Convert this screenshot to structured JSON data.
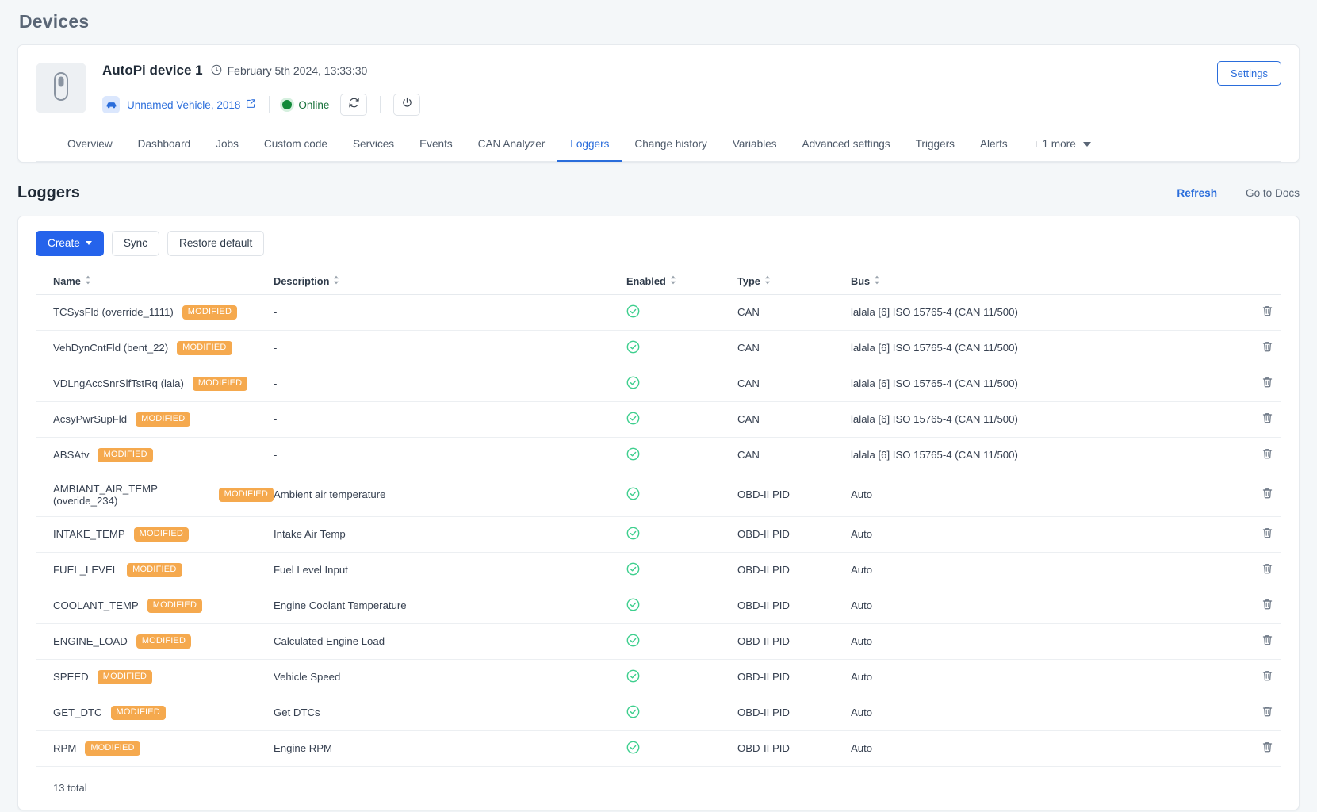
{
  "page": {
    "title": "Devices"
  },
  "device": {
    "thumb_icon": "usb-dongle-icon",
    "name": "AutoPi device 1",
    "clock_icon": "clock-icon",
    "date": "February 5th 2024, 13:33:30",
    "vehicle_icon": "car-icon",
    "vehicle_link": "Unnamed Vehicle, 2018",
    "external_link_icon": "external-link-icon",
    "status": "Online",
    "status_color": "#17713a",
    "refresh_icon": "refresh-icon",
    "power_icon": "power-icon",
    "settings_label": "Settings"
  },
  "tabs": [
    {
      "label": "Overview",
      "active": false
    },
    {
      "label": "Dashboard",
      "active": false
    },
    {
      "label": "Jobs",
      "active": false
    },
    {
      "label": "Custom code",
      "active": false
    },
    {
      "label": "Services",
      "active": false
    },
    {
      "label": "Events",
      "active": false
    },
    {
      "label": "CAN Analyzer",
      "active": false
    },
    {
      "label": "Loggers",
      "active": true
    },
    {
      "label": "Change history",
      "active": false
    },
    {
      "label": "Variables",
      "active": false
    },
    {
      "label": "Advanced settings",
      "active": false
    },
    {
      "label": "Triggers",
      "active": false
    },
    {
      "label": "Alerts",
      "active": false
    }
  ],
  "tabs_more": "+ 1 more",
  "section": {
    "title": "Loggers",
    "refresh_label": "Refresh",
    "docs_label": "Go to Docs"
  },
  "toolbar": {
    "create_label": "Create",
    "sync_label": "Sync",
    "restore_label": "Restore default"
  },
  "table": {
    "columns": [
      "Name",
      "Description",
      "Enabled",
      "Type",
      "Bus"
    ],
    "badge_label": "MODIFIED",
    "badge_color": "#f5a94e",
    "enabled_icon": "check-circle-icon",
    "enabled_color": "#3ecf8e",
    "delete_icon": "trash-icon",
    "rows": [
      {
        "name": "TCSysFld (override_1111)",
        "badge": "MODIFIED",
        "description": "-",
        "enabled": true,
        "type": "CAN",
        "bus": "lalala [6] ISO 15765-4 (CAN 11/500)"
      },
      {
        "name": "VehDynCntFld (bent_22)",
        "badge": "MODIFIED",
        "description": "-",
        "enabled": true,
        "type": "CAN",
        "bus": "lalala [6] ISO 15765-4 (CAN 11/500)"
      },
      {
        "name": "VDLngAccSnrSlfTstRq (lala)",
        "badge": "MODIFIED",
        "description": "-",
        "enabled": true,
        "type": "CAN",
        "bus": "lalala [6] ISO 15765-4 (CAN 11/500)"
      },
      {
        "name": "AcsyPwrSupFld",
        "badge": "MODIFIED",
        "description": "-",
        "enabled": true,
        "type": "CAN",
        "bus": "lalala [6] ISO 15765-4 (CAN 11/500)"
      },
      {
        "name": "ABSAtv",
        "badge": "MODIFIED",
        "description": "-",
        "enabled": true,
        "type": "CAN",
        "bus": "lalala [6] ISO 15765-4 (CAN 11/500)"
      },
      {
        "name": "AMBIANT_AIR_TEMP (overide_234)",
        "badge": "MODIFIED",
        "description": "Ambient air temperature",
        "enabled": true,
        "type": "OBD-II PID",
        "bus": "Auto"
      },
      {
        "name": "INTAKE_TEMP",
        "badge": "MODIFIED",
        "description": "Intake Air Temp",
        "enabled": true,
        "type": "OBD-II PID",
        "bus": "Auto"
      },
      {
        "name": "FUEL_LEVEL",
        "badge": "MODIFIED",
        "description": "Fuel Level Input",
        "enabled": true,
        "type": "OBD-II PID",
        "bus": "Auto"
      },
      {
        "name": "COOLANT_TEMP",
        "badge": "MODIFIED",
        "description": "Engine Coolant Temperature",
        "enabled": true,
        "type": "OBD-II PID",
        "bus": "Auto"
      },
      {
        "name": "ENGINE_LOAD",
        "badge": "MODIFIED",
        "description": "Calculated Engine Load",
        "enabled": true,
        "type": "OBD-II PID",
        "bus": "Auto"
      },
      {
        "name": "SPEED",
        "badge": "MODIFIED",
        "description": "Vehicle Speed",
        "enabled": true,
        "type": "OBD-II PID",
        "bus": "Auto"
      },
      {
        "name": "GET_DTC",
        "badge": "MODIFIED",
        "description": "Get DTCs",
        "enabled": true,
        "type": "OBD-II PID",
        "bus": "Auto"
      },
      {
        "name": "RPM",
        "badge": "MODIFIED",
        "description": "Engine RPM",
        "enabled": true,
        "type": "OBD-II PID",
        "bus": "Auto"
      }
    ],
    "total_label": "13 total"
  }
}
